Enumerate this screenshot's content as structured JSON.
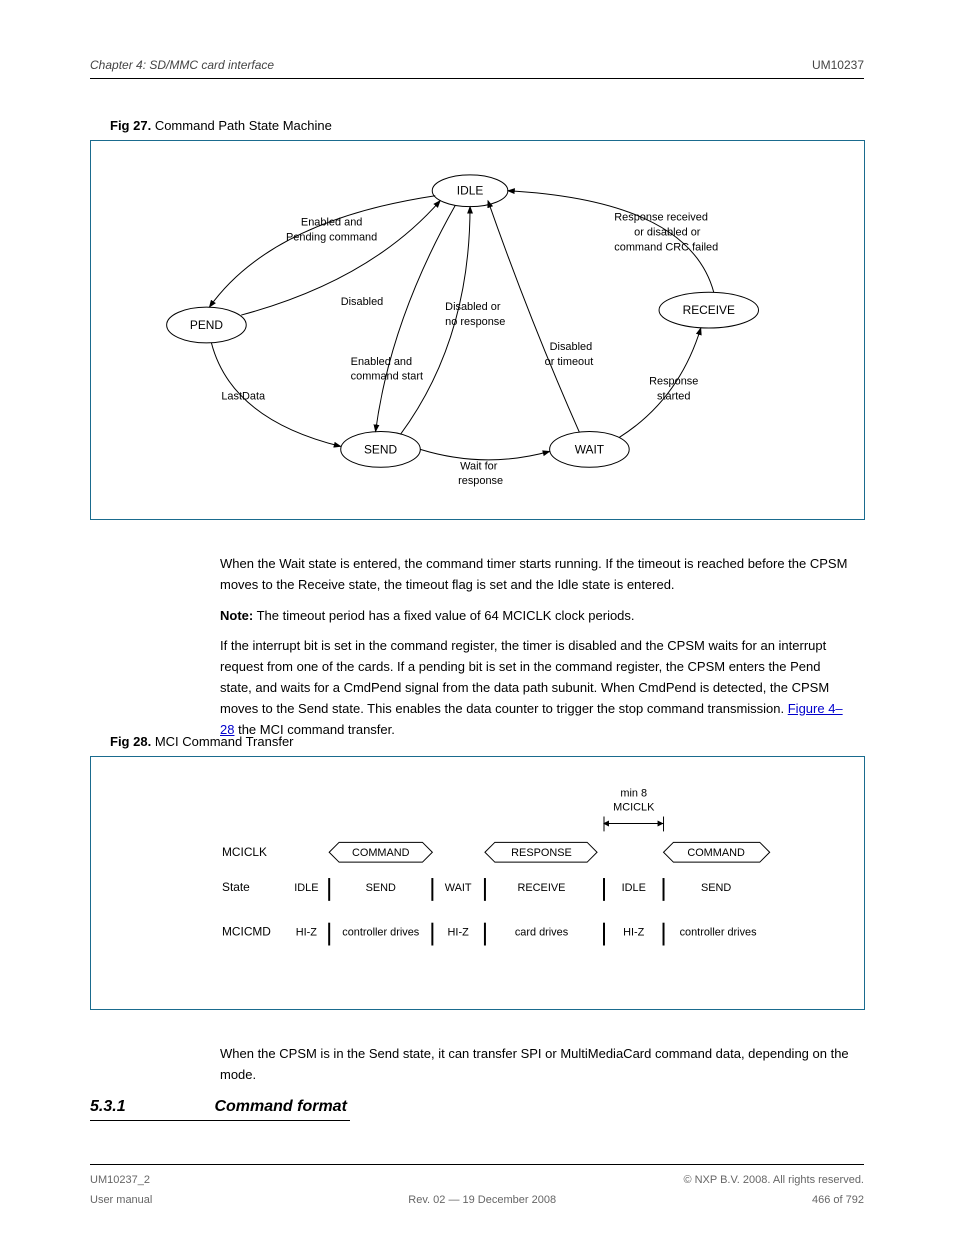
{
  "header": {
    "left_title": "Chapter 4:  SD/MMC card interface",
    "right_title": "UM10237"
  },
  "figure1": {
    "caption_num": "Fig 27.",
    "caption_text": "Command Path State Machine",
    "nodes": {
      "idle": "IDLE",
      "pend": "PEND",
      "send": "SEND",
      "wait": "WAIT",
      "receive": "RECEIVE"
    },
    "edges": {
      "idle_to_pend": "Enabled and Pending command",
      "pend_to_idle": "Disabled",
      "pend_to_send": "LastData",
      "idle_to_send": "Enabled and command start",
      "send_to_idle": "Disabled or no response",
      "send_to_wait": "Wait for response",
      "wait_to_idle": "Disabled or timeout",
      "wait_to_receive": "Response started",
      "receive_to_idle": "Response received or disabled or command CRC failed"
    }
  },
  "paragraph1": {
    "text_a": "When the Wait state is entered, the command timer starts running. If the timeout is reached before the CPSM moves to the Receive state, the timeout flag is set and the Idle state is entered.",
    "note_label": "Note:",
    "note_text": "The timeout period has a fixed value of 64 MCICLK clock periods.",
    "text_b_prefix": "If the interrupt bit is set in the command register, the timer is disabled and the CPSM waits for an interrupt request from one of the cards. If a pending bit is set in the command register, the CPSM enters the Pend state, and waits for a CmdPend signal from the data path subunit. When CmdPend is detected, the CPSM moves to the Send state. This enables the data counter to trigger the stop command transmission. ",
    "link": "Figure 4–28",
    "text_b_suffix": " the MCI command transfer."
  },
  "figure2": {
    "caption_num": "Fig 28.",
    "caption_text": "MCI Command Transfer",
    "row_labels": {
      "r1": "MCICLK",
      "r2": "State",
      "r3": "MCICMD"
    },
    "timeline": {
      "header": {
        "min8": "min 8",
        "mciclk": "MCICLK"
      },
      "r1": [
        "COMMAND",
        "RESPONSE",
        "COMMAND"
      ],
      "r2": [
        "IDLE",
        "SEND",
        "WAIT",
        "RECEIVE",
        "IDLE",
        "SEND"
      ],
      "r3": [
        "HI-Z",
        "controller drives",
        "HI-Z",
        "card drives",
        "HI-Z",
        "controller drives"
      ]
    }
  },
  "paragraph2": {
    "text": "When the CPSM is in the Send state, it can transfer SPI or MultiMediaCard command data, depending on the mode."
  },
  "subheading": {
    "num": "5.3.1",
    "title": "Command format"
  },
  "footer": {
    "left": "UM10237_2",
    "right_line1": "© NXP B.V. 2008. All rights reserved.",
    "right_line2_label": "User manual",
    "right_line2_mid": "Rev. 02 — 19 December 2008",
    "right_line2_page": "466 of 792"
  }
}
